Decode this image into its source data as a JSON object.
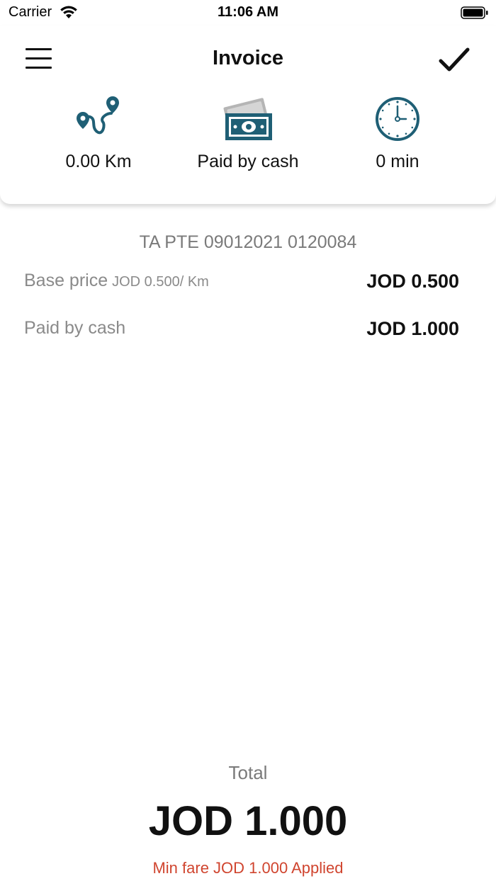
{
  "status_bar": {
    "carrier": "Carrier",
    "time": "11:06 AM"
  },
  "header": {
    "title": "Invoice",
    "menu_icon": "hamburger-menu-icon",
    "confirm_icon": "checkmark-icon"
  },
  "stats": [
    {
      "icon": "route-icon",
      "label": "0.00 Km"
    },
    {
      "icon": "cash-icon",
      "label": "Paid by cash"
    },
    {
      "icon": "clock-icon",
      "label": "0 min"
    }
  ],
  "trip_id": "TA PTE 09012021 0120084",
  "rows": [
    {
      "label": "Base price",
      "sub": "JOD 0.500/ Km",
      "value": "JOD 0.500"
    },
    {
      "label": "Paid by cash",
      "sub": "",
      "value": "JOD 1.000"
    }
  ],
  "total": {
    "label": "Total",
    "value": "JOD 1.000",
    "note": "Min fare JOD 1.000 Applied"
  },
  "colors": {
    "accent": "#1f5f75",
    "note": "#d0452f",
    "cash_gray": "#b5b5b5"
  }
}
